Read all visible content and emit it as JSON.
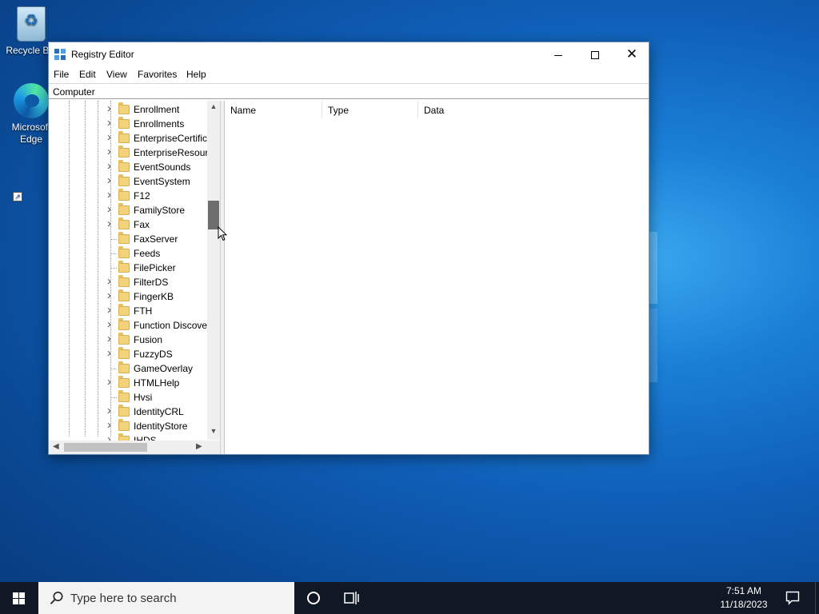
{
  "desktop": {
    "icons": [
      {
        "label": "Recycle Bin",
        "icon": "recycle-bin-icon"
      },
      {
        "label": "Microsoft Edge",
        "icon": "edge-icon"
      }
    ]
  },
  "window": {
    "title": "Registry Editor",
    "icon": "registry-editor-icon",
    "controls": {
      "minimize": "minimize-icon",
      "maximize": "maximize-icon",
      "close": "close-icon"
    },
    "menu": [
      "File",
      "Edit",
      "View",
      "Favorites",
      "Help"
    ],
    "address": "Computer",
    "tree": {
      "items": [
        {
          "label": "Enrollment",
          "expandable": true
        },
        {
          "label": "Enrollments",
          "expandable": true
        },
        {
          "label": "EnterpriseCertific",
          "expandable": true
        },
        {
          "label": "EnterpriseResourc",
          "expandable": true
        },
        {
          "label": "EventSounds",
          "expandable": true
        },
        {
          "label": "EventSystem",
          "expandable": true
        },
        {
          "label": "F12",
          "expandable": true
        },
        {
          "label": "FamilyStore",
          "expandable": true
        },
        {
          "label": "Fax",
          "expandable": true
        },
        {
          "label": "FaxServer",
          "expandable": false
        },
        {
          "label": "Feeds",
          "expandable": false
        },
        {
          "label": "FilePicker",
          "expandable": false
        },
        {
          "label": "FilterDS",
          "expandable": true
        },
        {
          "label": "FingerKB",
          "expandable": true
        },
        {
          "label": "FTH",
          "expandable": true
        },
        {
          "label": "Function Discove",
          "expandable": true
        },
        {
          "label": "Fusion",
          "expandable": true
        },
        {
          "label": "FuzzyDS",
          "expandable": true
        },
        {
          "label": "GameOverlay",
          "expandable": false
        },
        {
          "label": "HTMLHelp",
          "expandable": true
        },
        {
          "label": "Hvsi",
          "expandable": false
        },
        {
          "label": "IdentityCRL",
          "expandable": true
        },
        {
          "label": "IdentityStore",
          "expandable": true
        },
        {
          "label": "IHDS",
          "expandable": true
        }
      ]
    },
    "list": {
      "columns": [
        "Name",
        "Type",
        "Data"
      ],
      "rows": []
    }
  },
  "taskbar": {
    "search_placeholder": "Type here to search",
    "time": "7:51 AM",
    "date": "11/18/2023"
  },
  "colors": {
    "taskbar": "#101826",
    "folder": "#f3d27a",
    "desktop_accent": "#1a7fd6"
  }
}
